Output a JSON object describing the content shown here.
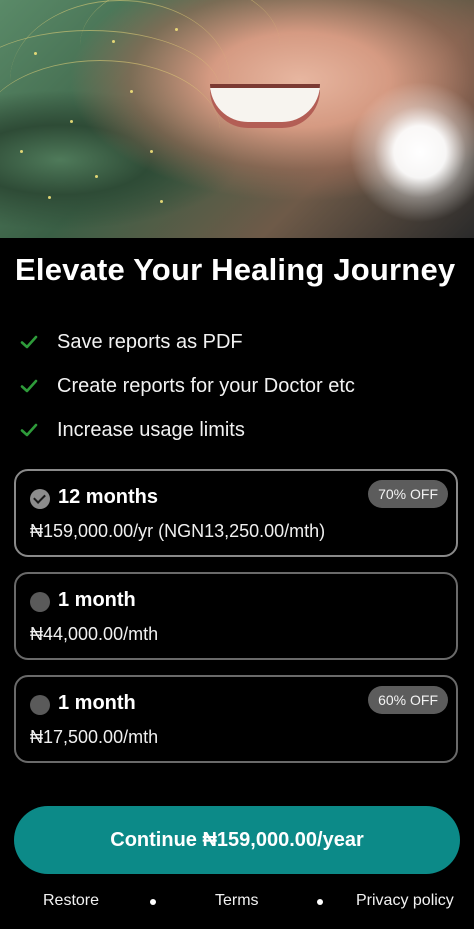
{
  "title": "Elevate Your Healing Journey",
  "features": [
    {
      "label": "Save reports as PDF",
      "icon": "check-icon"
    },
    {
      "label": "Create reports for your Doctor etc",
      "icon": "check-icon"
    },
    {
      "label": "Increase usage limits",
      "icon": "check-icon"
    }
  ],
  "plans": [
    {
      "title": "12 months",
      "price": "₦159,000.00/yr (NGN13,250.00/mth)",
      "badge": "70% OFF",
      "selected": true
    },
    {
      "title": "1 month",
      "price": "₦44,000.00/mth",
      "badge": "",
      "selected": false
    },
    {
      "title": "1 month",
      "price": "₦17,500.00/mth",
      "badge": "60% OFF",
      "selected": false
    }
  ],
  "cta": {
    "label": "Continue ₦159,000.00/year"
  },
  "footer": {
    "restore": "Restore",
    "terms": "Terms",
    "privacy": "Privacy policy"
  },
  "colors": {
    "background": "#000000",
    "accent": "#0c8a88",
    "check": "#2e9b3a",
    "badge": "#5c5c5c"
  }
}
